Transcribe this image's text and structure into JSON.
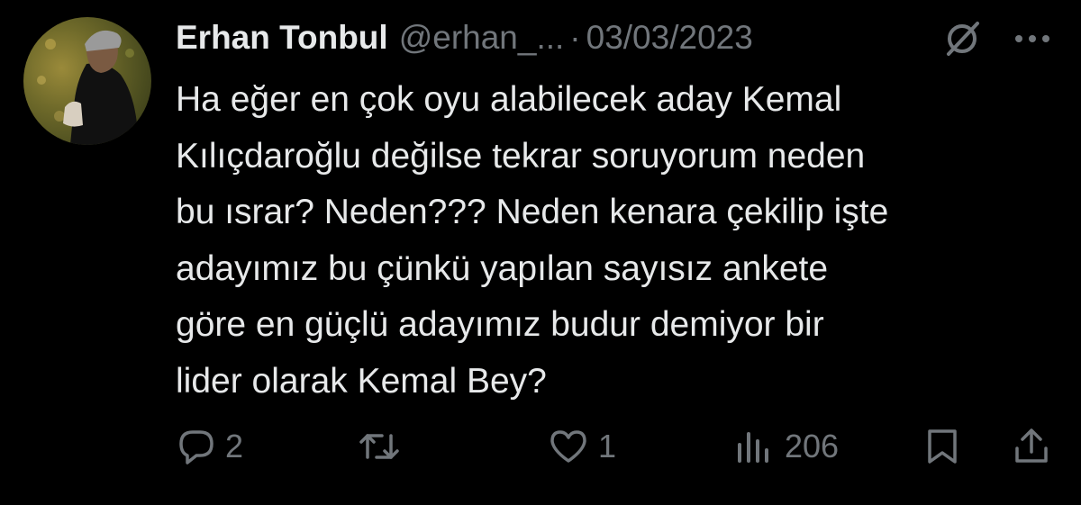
{
  "author": {
    "display_name": "Erhan Tonbul",
    "handle": "@erhan_...",
    "separator": "·",
    "date": "03/03/2023"
  },
  "tweet": {
    "text": "Ha eğer en çok oyu alabilecek aday Kemal\nKılıçdaroğlu değilse tekrar soruyorum neden\nbu ısrar? Neden??? Neden kenara çekilip işte\nadayımız bu çünkü yapılan sayısız ankete\ngöre en güçlü adayımız budur demiyor bir\nlider olarak Kemal Bey?"
  },
  "actions": {
    "replies": "2",
    "retweets": "",
    "likes": "1",
    "views": "206"
  },
  "icons": {
    "header": [
      "grok-icon",
      "more-icon"
    ],
    "actions": [
      "reply-icon",
      "retweet-icon",
      "like-icon",
      "views-icon",
      "bookmark-icon",
      "share-icon"
    ]
  },
  "colors": {
    "background": "#000000",
    "primary_text": "#e7e9ea",
    "secondary_text": "#71767b"
  }
}
